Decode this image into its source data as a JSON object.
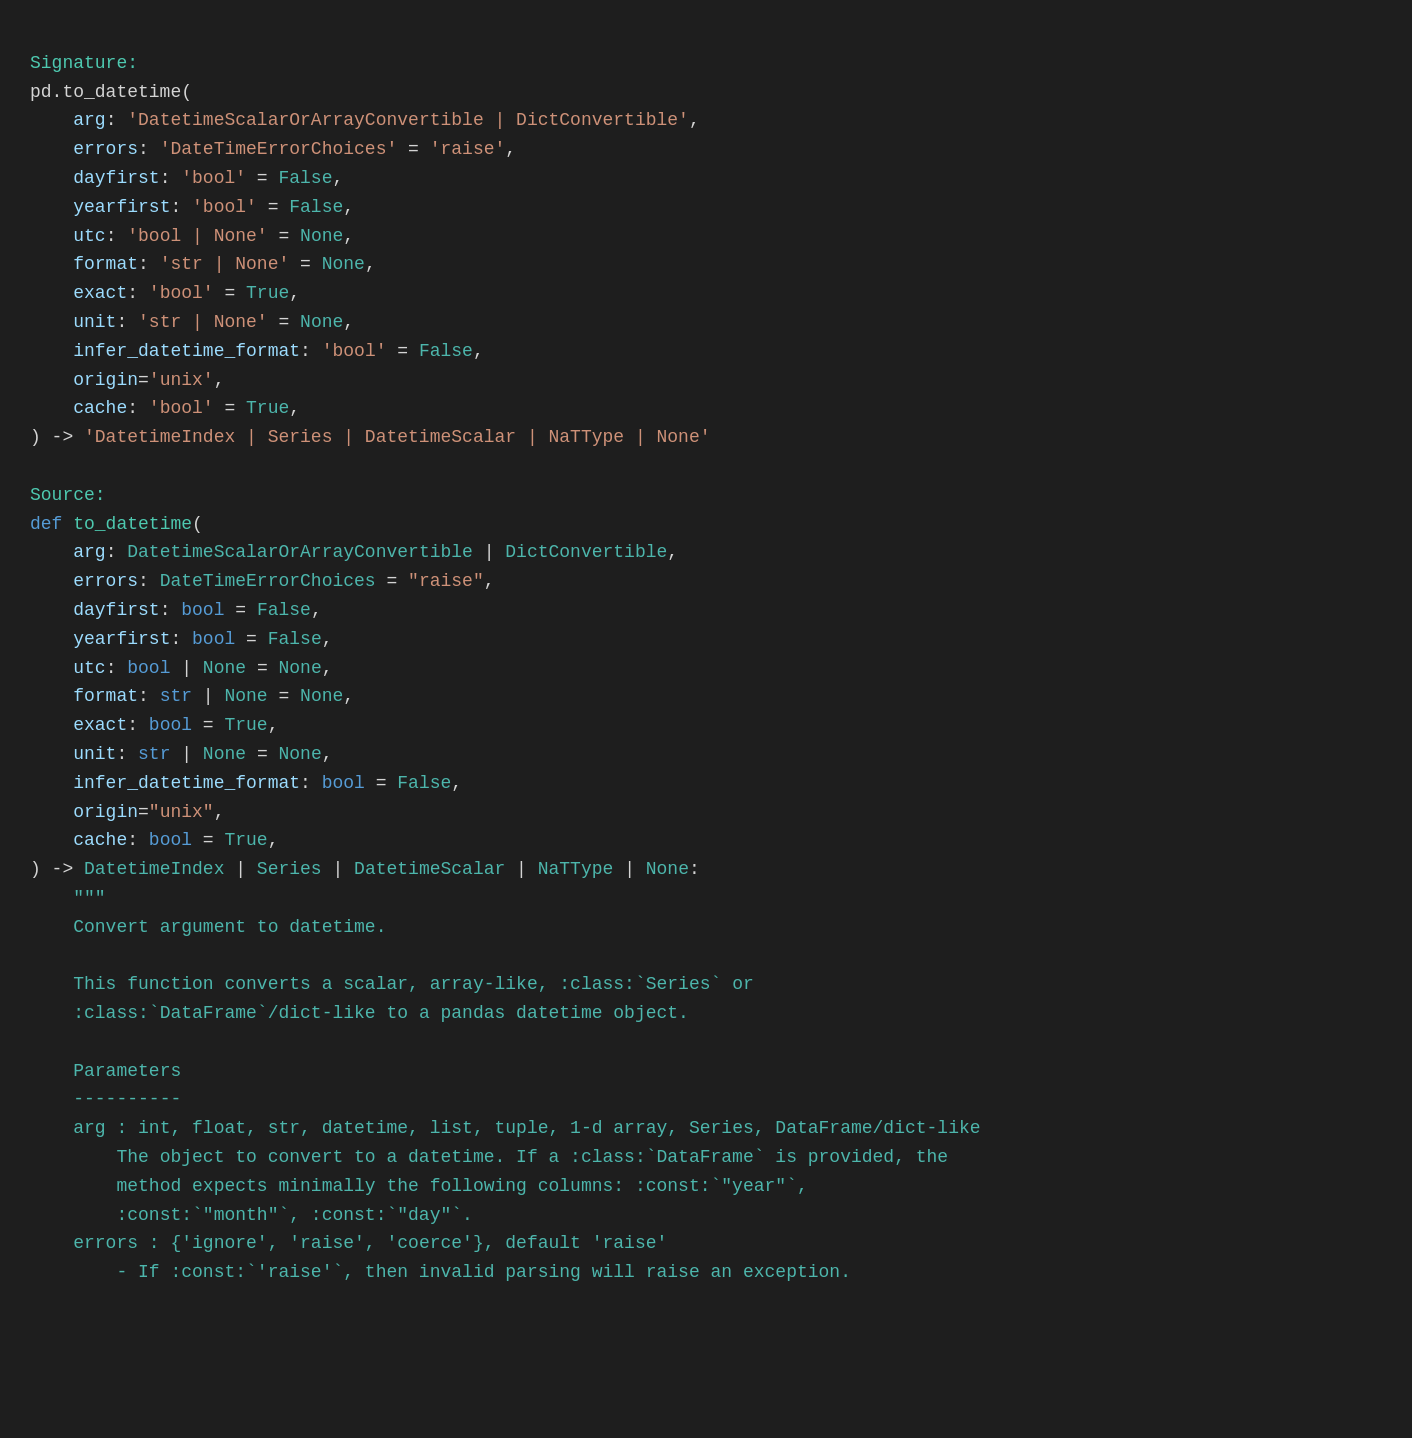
{
  "content": {
    "signature_label": "Signature:",
    "source_label": "Source:",
    "lines": []
  }
}
